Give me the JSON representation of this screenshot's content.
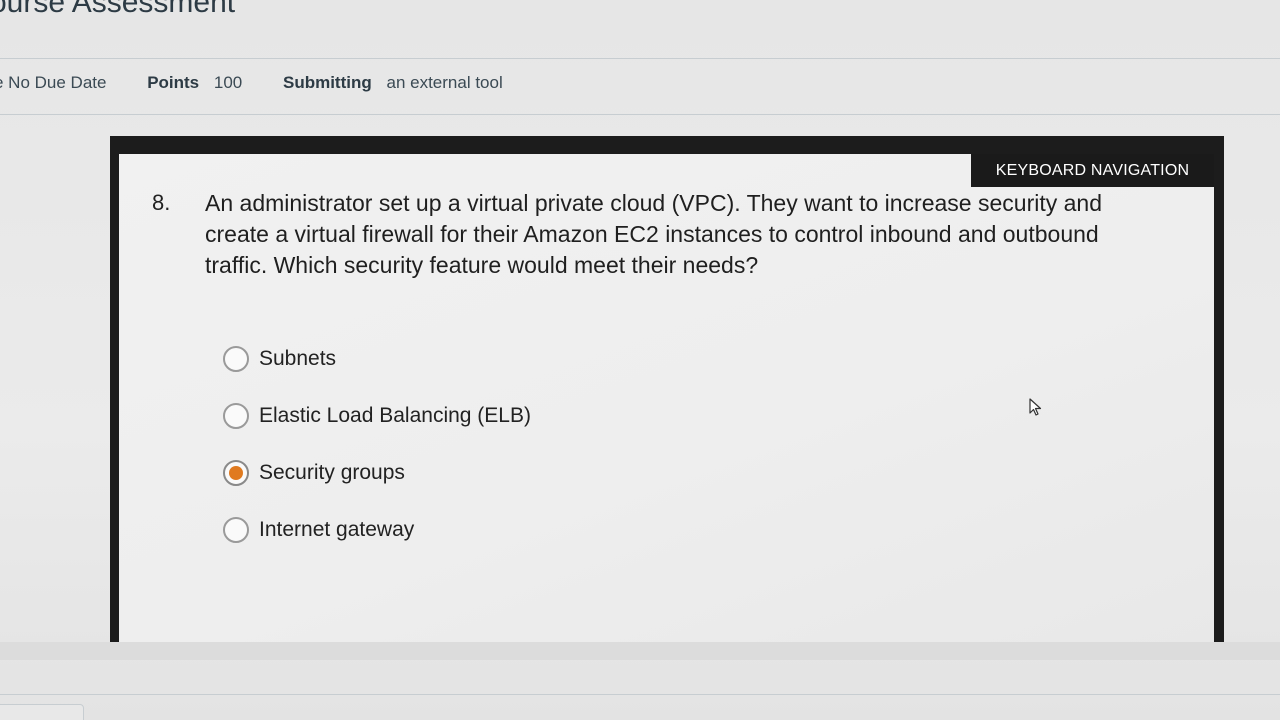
{
  "page": {
    "title": "ourse Assessment"
  },
  "meta": {
    "due_value": "e  No Due Date",
    "points_label": "Points",
    "points_value": "100",
    "submitting_label": "Submitting",
    "submitting_value": "an external tool"
  },
  "tool": {
    "keyboard_navigation_label": "KEYBOARD NAVIGATION",
    "question": {
      "number": "8.",
      "text": "An administrator set up a virtual private cloud (VPC). They want to increase security and create a virtual firewall for their Amazon EC2 instances to control inbound and outbound traffic. Which security feature would meet their needs?"
    },
    "options": [
      {
        "label": "Subnets",
        "selected": false
      },
      {
        "label": "Elastic Load Balancing (ELB)",
        "selected": false
      },
      {
        "label": "Security groups",
        "selected": true
      },
      {
        "label": "Internet gateway",
        "selected": false
      }
    ],
    "selected_color": "#e07a1f"
  },
  "icons": {
    "cursor": "mouse-pointer-icon"
  }
}
